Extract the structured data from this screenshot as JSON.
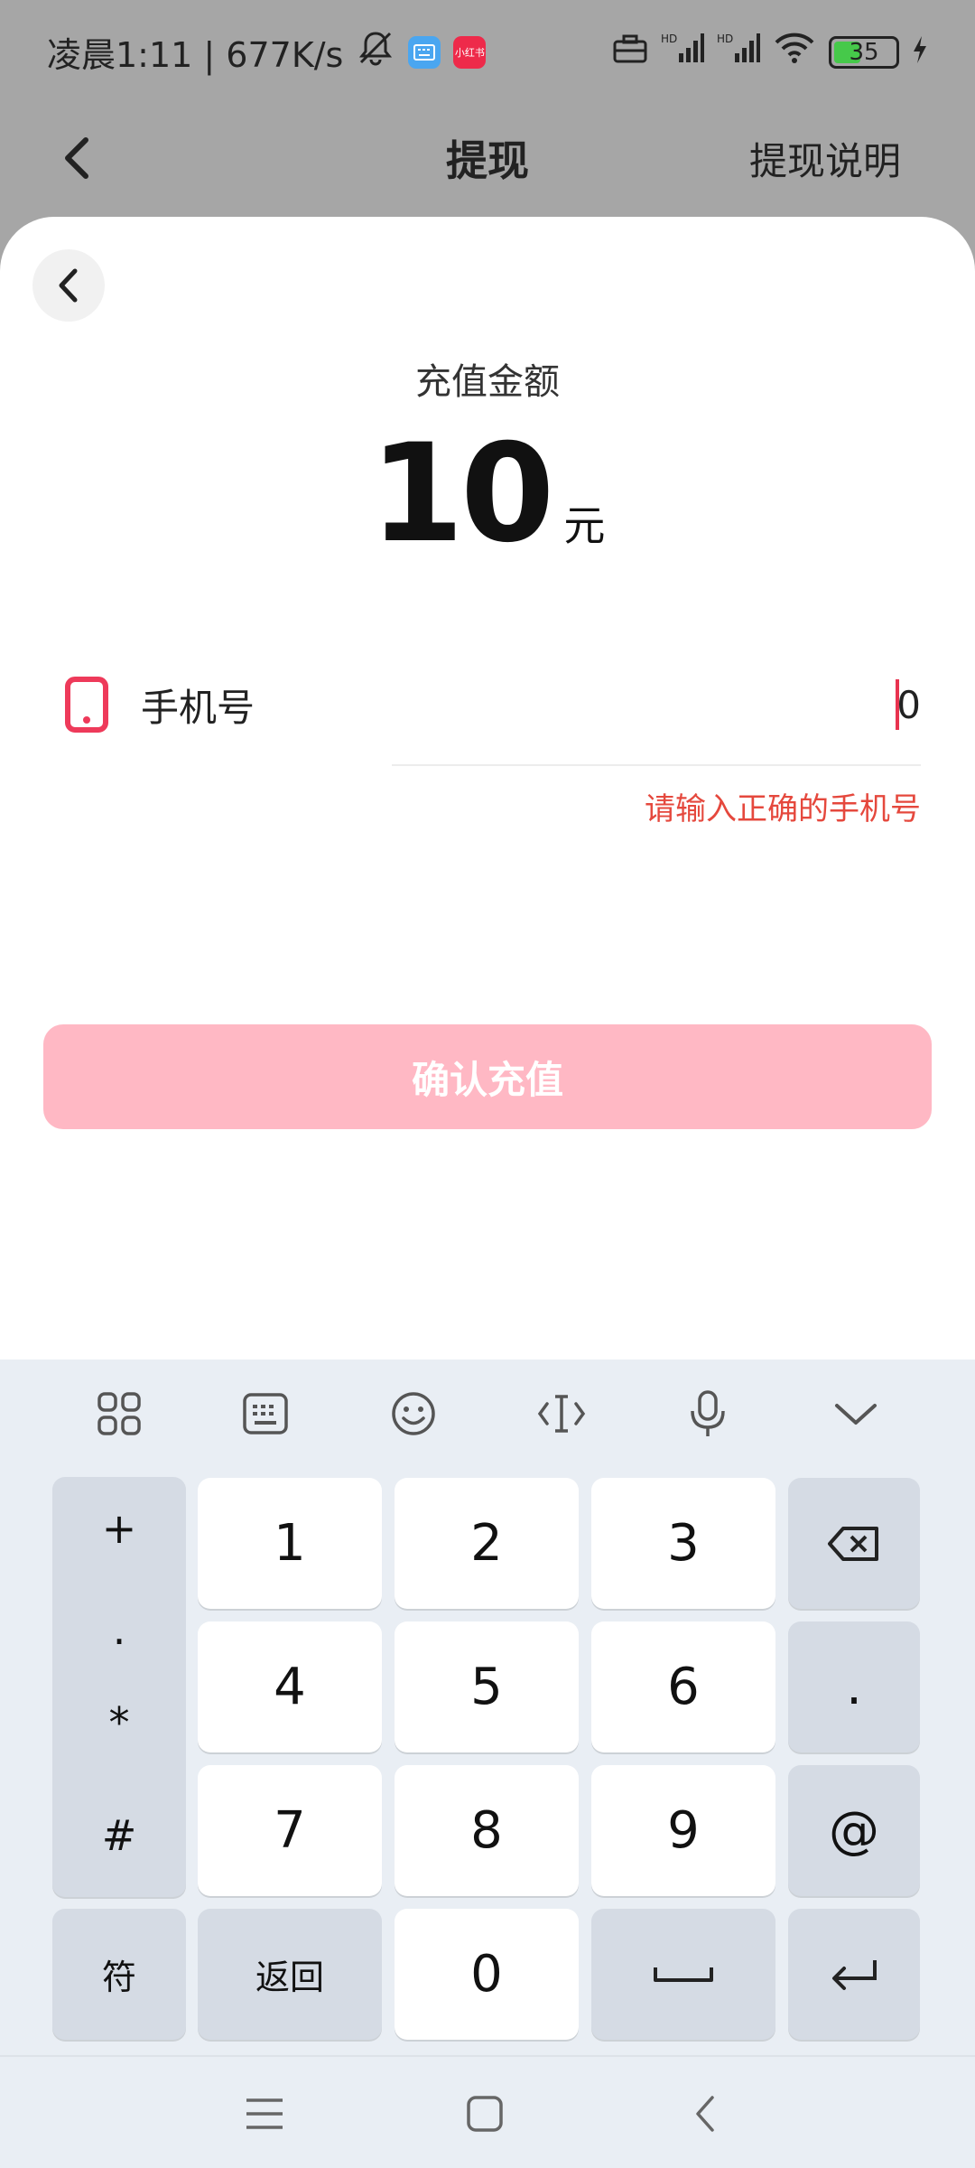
{
  "status_bar": {
    "time_speed": "凌晨1:11 | 677K/s",
    "app_badge_1": "",
    "app_badge_2": "小红书",
    "battery": "35"
  },
  "nav": {
    "title": "提现",
    "right_link": "提现说明"
  },
  "recharge": {
    "amount_label": "充值金额",
    "amount_value": "10",
    "amount_unit": "元",
    "phone_label": "手机号",
    "phone_value": "0",
    "error_message": "请输入正确的手机号",
    "confirm_label": "确认充值"
  },
  "keyboard": {
    "symbols": [
      "+",
      "·",
      "*",
      "#"
    ],
    "row1": [
      "1",
      "2",
      "3"
    ],
    "row2": [
      "4",
      "5",
      "6"
    ],
    "row3": [
      "7",
      "8",
      "9"
    ],
    "dot_key": ".",
    "at_key": "@",
    "fu_key": "符",
    "back_key": "返回",
    "zero_key": "0"
  },
  "colors": {
    "accent": "#ffb8c4",
    "error": "#e5483d",
    "phone_icon": "#ee3a5a"
  }
}
